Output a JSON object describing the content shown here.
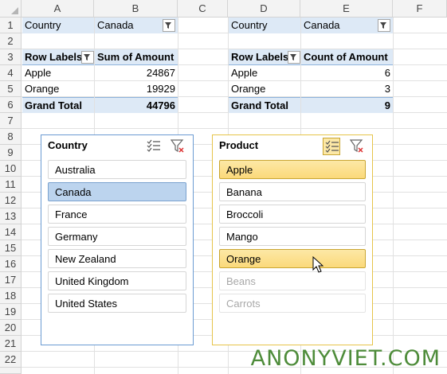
{
  "columns": [
    "A",
    "B",
    "C",
    "D",
    "E",
    "F"
  ],
  "rows": [
    "1",
    "2",
    "3",
    "4",
    "5",
    "6",
    "7",
    "8",
    "9",
    "10",
    "11",
    "12",
    "13",
    "14",
    "15",
    "16",
    "17",
    "18",
    "19",
    "20",
    "21",
    "22"
  ],
  "pivot1": {
    "filter_label": "Country",
    "filter_value": "Canada",
    "row_labels": "Row Labels",
    "value_header": "Sum of Amount",
    "rows": [
      {
        "label": "Apple",
        "value": "24867"
      },
      {
        "label": "Orange",
        "value": "19929"
      }
    ],
    "total_label": "Grand Total",
    "total_value": "44796"
  },
  "pivot2": {
    "filter_label": "Country",
    "filter_value": "Canada",
    "row_labels": "Row Labels",
    "value_header": "Count of Amount",
    "rows": [
      {
        "label": "Apple",
        "value": "6"
      },
      {
        "label": "Orange",
        "value": "3"
      }
    ],
    "total_label": "Grand Total",
    "total_value": "9"
  },
  "slicer_country": {
    "title": "Country",
    "items": [
      {
        "label": "Australia",
        "state": "off"
      },
      {
        "label": "Canada",
        "state": "selected"
      },
      {
        "label": "France",
        "state": "off"
      },
      {
        "label": "Germany",
        "state": "off"
      },
      {
        "label": "New Zealand",
        "state": "off"
      },
      {
        "label": "United Kingdom",
        "state": "off"
      },
      {
        "label": "United States",
        "state": "off"
      }
    ]
  },
  "slicer_product": {
    "title": "Product",
    "items": [
      {
        "label": "Apple",
        "state": "selected"
      },
      {
        "label": "Banana",
        "state": "off"
      },
      {
        "label": "Broccoli",
        "state": "off"
      },
      {
        "label": "Mango",
        "state": "off"
      },
      {
        "label": "Orange",
        "state": "selected"
      },
      {
        "label": "Beans",
        "state": "nodata"
      },
      {
        "label": "Carrots",
        "state": "nodata"
      }
    ]
  },
  "colors": {
    "country_border": "#6b9bd2",
    "product_border": "#e6c44a",
    "selected_blue": "#bcd4ee",
    "selected_yellow": "#fbd97a",
    "pivot_fill": "#dde9f6"
  },
  "icons": [
    "multi-select-icon",
    "clear-filter-icon",
    "filter-dropdown-icon",
    "mouse-cursor-icon"
  ],
  "watermark": "ANONYVIET.COM"
}
